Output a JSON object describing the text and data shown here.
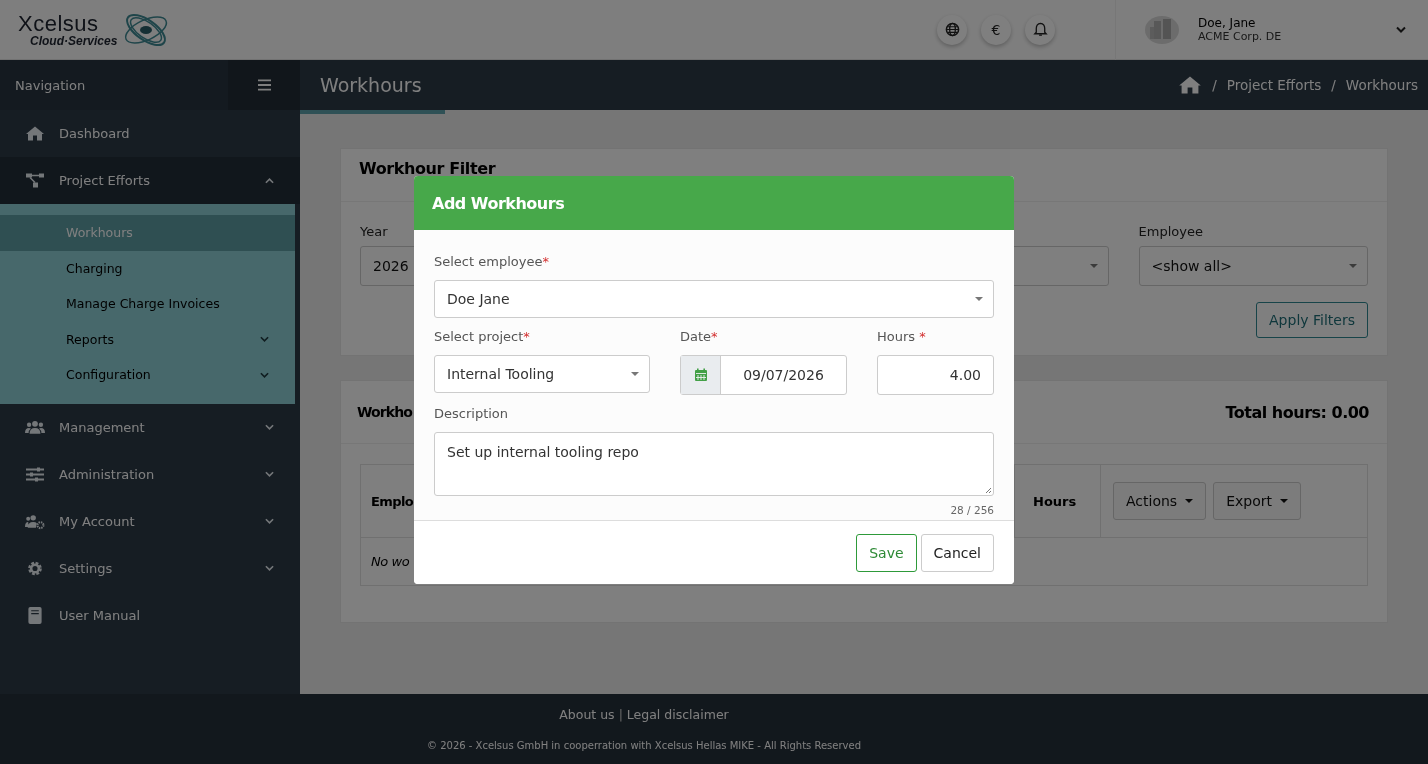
{
  "header": {
    "logo": {
      "name": "Xcelsus",
      "tagline": "Cloud·Services"
    },
    "icons": [
      {
        "kind": "globe"
      },
      {
        "kind": "currency",
        "symbol": "€"
      },
      {
        "kind": "bell"
      }
    ],
    "user": {
      "name": "Doe, Jane",
      "company": "ACME Corp. DE"
    }
  },
  "sidebar": {
    "title": "Navigation",
    "items": [
      {
        "label": "Dashboard",
        "expanded": false,
        "selected": false
      },
      {
        "label": "Project Efforts",
        "expanded": true,
        "selected": false,
        "children": [
          {
            "label": "Workhours",
            "selected": true
          },
          {
            "label": "Charging",
            "selected": false
          },
          {
            "label": "Manage Charge Invoices",
            "selected": false
          },
          {
            "label": "Reports",
            "selected": false,
            "expandable": true
          },
          {
            "label": "Configuration",
            "selected": false,
            "expandable": true
          }
        ]
      },
      {
        "label": "Management",
        "expanded": false,
        "selected": false,
        "expandable": true
      },
      {
        "label": "Administration",
        "expanded": false,
        "selected": false,
        "expandable": true
      },
      {
        "label": "My Account",
        "expanded": false,
        "selected": false,
        "expandable": true
      },
      {
        "label": "Settings",
        "expanded": false,
        "selected": false,
        "expandable": true
      },
      {
        "label": "User Manual",
        "expanded": false,
        "selected": false
      }
    ]
  },
  "page": {
    "title": "Workhours",
    "breadcrumb": {
      "separator": "/",
      "items": [
        "Project Efforts",
        "Workhours"
      ]
    }
  },
  "filter": {
    "title": "Workhour Filter",
    "fields": [
      {
        "kind": "select",
        "label": "Year",
        "value": "2026"
      },
      {
        "kind": "select"
      },
      {
        "kind": "select",
        "label": "Employee",
        "value": "<show all>"
      }
    ],
    "apply": "Apply Filters"
  },
  "list": {
    "title": "Workho",
    "total": "Total hours: 0.00",
    "columns": [
      "Emplo",
      "Hours"
    ],
    "actions": [
      "Actions",
      "Export"
    ],
    "empty": "No wo"
  },
  "modal": {
    "title": "Add Workhours",
    "employee": {
      "label": "Select employee",
      "mark": "*",
      "value": "Doe Jane"
    },
    "project": {
      "label": "Select project",
      "mark": "*",
      "value": "Internal Tooling"
    },
    "date": {
      "label": "Date",
      "mark": "*",
      "value": "09/07/2026"
    },
    "hours": {
      "label": "Hours",
      "mark": " *",
      "value": "4.00"
    },
    "description": {
      "label": "Description",
      "value": "Set up internal tooling repo",
      "counter": "28 / 256"
    },
    "buttons": [
      {
        "kind": "primary",
        "label": "Save"
      },
      {
        "kind": "secondary",
        "label": "Cancel"
      }
    ]
  },
  "footer": {
    "links": [
      "About us",
      "Legal disclaimer"
    ],
    "divider": "|",
    "copyright": "© 2026 - Xcelsus GmbH in cooperration with Xcelsus Hellas MIKE - All Rights Reserved"
  }
}
